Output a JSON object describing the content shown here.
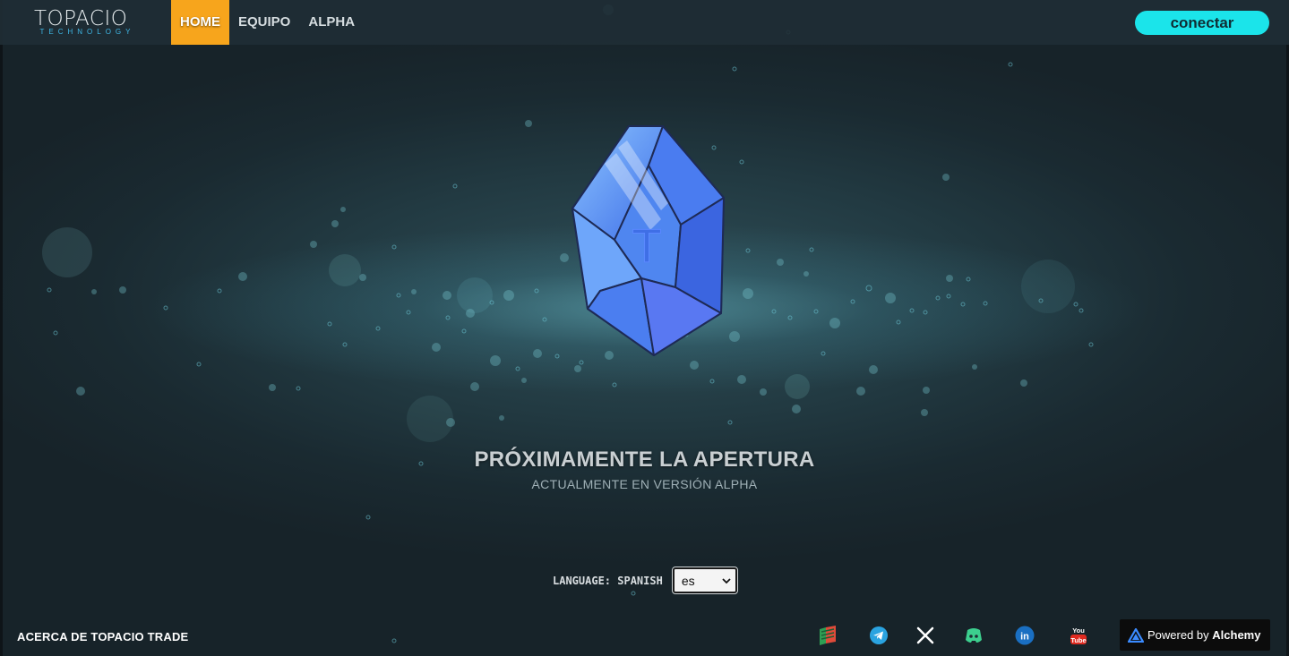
{
  "header": {
    "logo_name": "TOPACIO",
    "logo_sub": "TECHNOLOGY",
    "nav": [
      {
        "label": "HOME",
        "active": true
      },
      {
        "label": "EQUIPO",
        "active": false
      },
      {
        "label": "ALPHA",
        "active": false
      }
    ],
    "connect_label": "conectar"
  },
  "hero": {
    "gem_letter": "T",
    "headline": "PRÓXIMAMENTE LA APERTURA",
    "subline": "ACTUALMENTE EN VERSIÓN ALPHA"
  },
  "language": {
    "label": "LANGUAGE: SPANISH",
    "selected": "es"
  },
  "footer": {
    "about_label": "ACERCA DE TOPACIO TRADE",
    "social_icons": [
      "book-icon",
      "telegram-icon",
      "x-icon",
      "discord-icon",
      "linkedin-icon",
      "youtube-icon"
    ],
    "alchemy": {
      "prefix": "Powered by",
      "brand": "Alchemy"
    }
  },
  "colors": {
    "active_nav": "#f7a51c",
    "connect_button": "#1be4ea",
    "gem_blue": "#4f86f0",
    "background": "#1f3138"
  }
}
